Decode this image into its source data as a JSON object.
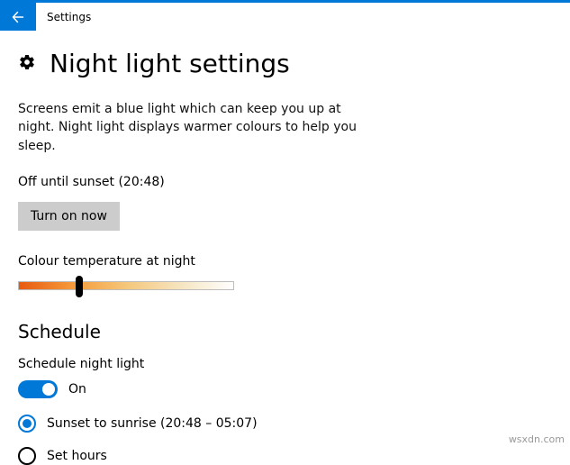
{
  "titlebar": {
    "title": "Settings"
  },
  "page": {
    "heading": "Night light settings",
    "description": "Screens emit a blue light which can keep you up at night. Night light displays warmer colours to help you sleep.",
    "status": "Off until sunset (20:48)",
    "turn_on_label": "Turn on now",
    "temp_label": "Colour temperature at night",
    "temp_value_percent": 28
  },
  "schedule": {
    "heading": "Schedule",
    "label": "Schedule night light",
    "toggle_state": "On",
    "options": [
      {
        "label": "Sunset to sunrise (20:48 – 05:07)",
        "selected": true
      },
      {
        "label": "Set hours",
        "selected": false
      }
    ]
  },
  "watermark": "wsxdn.com",
  "colors": {
    "accent": "#0078d7"
  }
}
